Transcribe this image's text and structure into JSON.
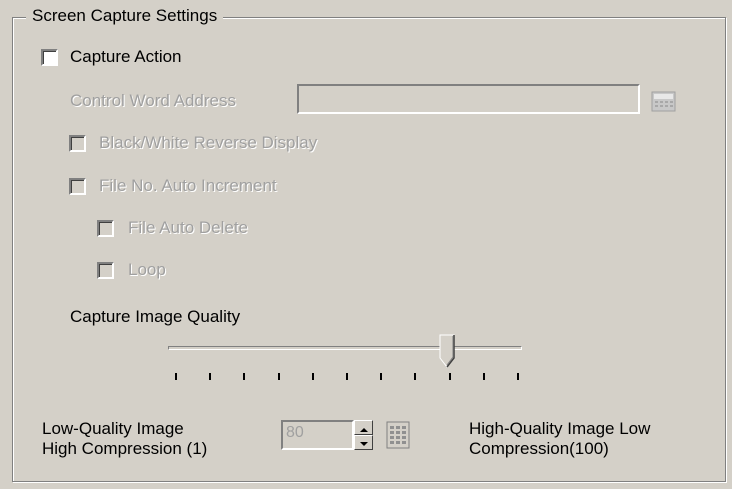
{
  "group": {
    "title": "Screen Capture Settings"
  },
  "capture_action": {
    "label": "Capture Action",
    "checked": false
  },
  "control_word": {
    "label": "Control Word Address",
    "value": ""
  },
  "options": {
    "bw_reverse": "Black/White Reverse Display",
    "auto_increment": "File No. Auto Increment",
    "auto_delete": "File Auto Delete",
    "loop": "Loop"
  },
  "quality": {
    "label": "Capture Image Quality",
    "value": 80,
    "min": 1,
    "max": 100,
    "low_label_1": "Low-Quality Image",
    "low_label_2": "High Compression (1)",
    "high_label_1": "High-Quality Image Low",
    "high_label_2": "Compression(100)",
    "spin_value": "80"
  }
}
